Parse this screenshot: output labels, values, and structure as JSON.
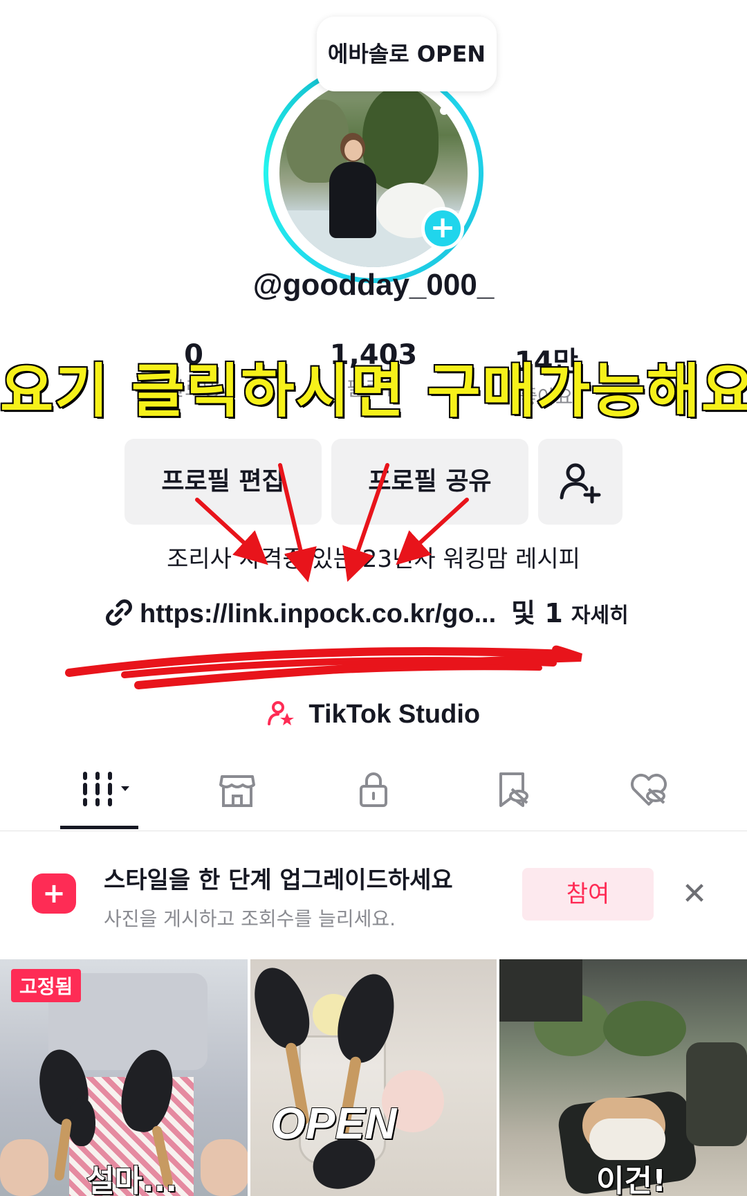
{
  "profile": {
    "note": "에바솔로 OPEN",
    "username": "@goodday_000_",
    "stats": [
      {
        "value": "0",
        "label": "팔로잉"
      },
      {
        "value": "1,403",
        "label": "팔로워"
      },
      {
        "value": "14만",
        "label": "좋아요"
      }
    ],
    "overlay_caption": "요기 클릭하시면 구매가능해요",
    "bio": "조리사 자격증 있는 23년차 워킹맘 레시피",
    "link": {
      "url": "https://link.inpock.co.kr/go...",
      "more": "및 1",
      "more_detail": "자세히"
    },
    "studio": "TikTok Studio"
  },
  "buttons": {
    "edit": "프로필 편집",
    "share": "프로필 공유"
  },
  "tabs": [
    {
      "name": "videos",
      "icon": "grid-icon"
    },
    {
      "name": "shop",
      "icon": "storefront-icon"
    },
    {
      "name": "private",
      "icon": "lock-icon"
    },
    {
      "name": "saved",
      "icon": "bookmark-hidden-icon"
    },
    {
      "name": "liked",
      "icon": "heart-hidden-icon"
    }
  ],
  "promo": {
    "title": "스타일을 한 단계 업그레이드하세요",
    "subtitle": "사진을 게시하고 조회수를 늘리세요.",
    "join": "참여",
    "close": "✕"
  },
  "videos": [
    {
      "pinned_label": "고정됨",
      "caption": "설마..."
    },
    {
      "caption": "OPEN"
    },
    {
      "caption": "이건!"
    }
  ],
  "colors": {
    "accent": "#fe2c55",
    "ring": "#20d5ec",
    "caption_yellow": "#f6f11a",
    "annotation_red": "#e8141b"
  }
}
